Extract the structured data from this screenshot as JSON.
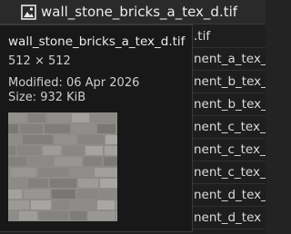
{
  "header": {
    "icon": "image-file-icon",
    "filename": "wall_stone_bricks_a_tex_d.tif"
  },
  "file_list": {
    "rows": [
      ".tif",
      "nent_a_tex_n",
      "nent_b_tex_d",
      "nent_b_tex_n",
      "nent_c_tex_d",
      "nent_c_tex_n",
      "nent_c_tex_n",
      "nent_d_tex_d",
      "nent_d_tex"
    ]
  },
  "tooltip": {
    "name": "wall_stone_bricks_a_tex_d.tif",
    "dimensions": "512 × 512",
    "modified": "Modified: 06 Apr 2026",
    "size": "Size: 932 KiB",
    "thumbnail_icon": "stone-bricks-texture-thumbnail"
  },
  "colors": {
    "background": "#1e1e1e",
    "tooltip_bg": "#181818",
    "text": "#e6e6e6"
  }
}
